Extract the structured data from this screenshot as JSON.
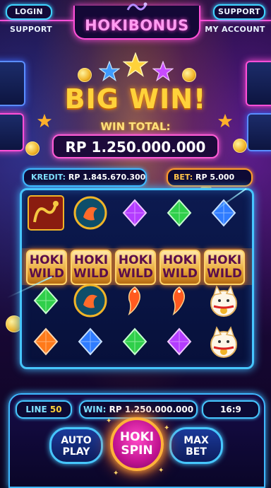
{
  "nav": {
    "login": "LOGIN",
    "support_top": "SUPPORT",
    "support_left": "SUPPORT",
    "my_account": "MY ACCOUNT",
    "logo_hoki": "HOKI",
    "logo_bonus": "BONUS"
  },
  "win_banner": {
    "title": "BIG WIN!",
    "total_label": "WIN TOTAL:",
    "total_value": "RP 1.250.000.000"
  },
  "credit": {
    "label": "KREDIT:",
    "value": "RP 1.845.670.300"
  },
  "bet": {
    "label": "BET:",
    "value": "RP 5.000"
  },
  "reels": {
    "rows": [
      [
        "dragon-tile",
        "koi-medallion",
        "purple-gem",
        "green-gem",
        "blue-gem"
      ],
      [
        "hoki-wild",
        "hoki-wild",
        "hoki-wild",
        "hoki-wild",
        "hoki-wild"
      ],
      [
        "green-gem",
        "koi-medallion",
        "koi-fish",
        "koi-fish",
        "lucky-cat"
      ],
      [
        "orange-gem",
        "blue-gem",
        "green-gem",
        "purple-gem",
        "lucky-cat"
      ]
    ],
    "wild_line1": "HOKI",
    "wild_line2": "WILD"
  },
  "controls": {
    "line_label": "LINE",
    "line_value": "50",
    "win_label": "WIN:",
    "win_value": "RP 1.250.000.000",
    "aspect": "16:9",
    "autoplay_line1": "AUTO",
    "autoplay_line2": "PLAY",
    "spin_line1": "HOKI",
    "spin_line2": "SPIN",
    "maxbet_line1": "MAX",
    "maxbet_line2": "BET"
  },
  "colors": {
    "neon_cyan": "#3fb8ff",
    "neon_pink": "#ff4fd8",
    "gold": "#ffd23a",
    "spin_magenta": "#c11391"
  }
}
